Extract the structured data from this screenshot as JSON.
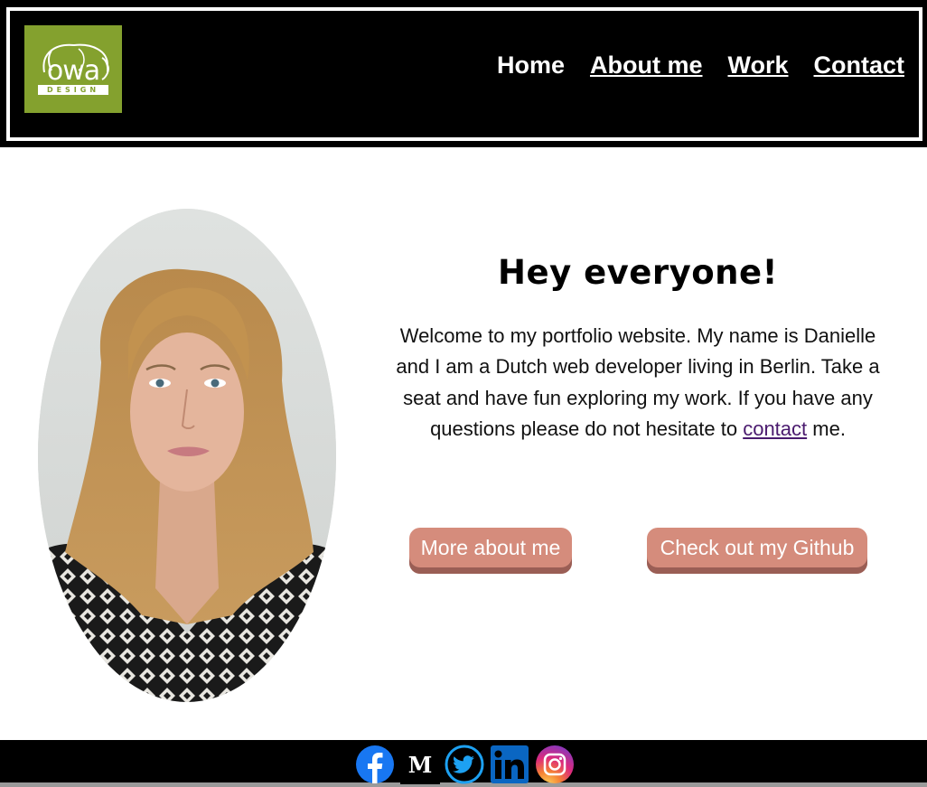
{
  "header": {
    "logo": {
      "wordmark": "owa",
      "subtext": "DESIGN",
      "color": "#84a12e"
    },
    "nav": [
      {
        "label": "Home"
      },
      {
        "label": "About me"
      },
      {
        "label": "Work"
      },
      {
        "label": "Contact"
      }
    ]
  },
  "hero": {
    "title": "Hey everyone!",
    "body_before": "Welcome to my portfolio website. My name is Danielle and I am a Dutch web developer living in Berlin. Take a seat and have fun exploring my work. If you have any questions please do not hesitate to ",
    "body_link": "contact",
    "body_after": " me.",
    "buttons": {
      "about": "More about me",
      "github": "Check out my Github"
    },
    "button_color": "#d58c7c"
  },
  "footer": {
    "social_icons": [
      "facebook-icon",
      "medium-icon",
      "twitter-icon",
      "linkedin-icon",
      "instagram-icon"
    ],
    "medium_glyph": "M"
  }
}
